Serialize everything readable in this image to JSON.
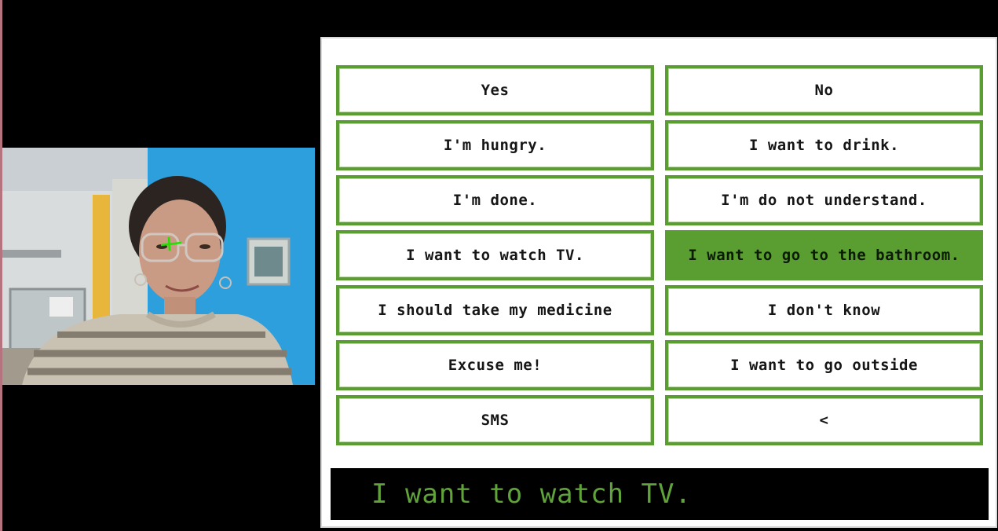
{
  "phrase_board": {
    "phrases": [
      {
        "label": "Yes",
        "selected": false
      },
      {
        "label": "No",
        "selected": false
      },
      {
        "label": "I'm hungry.",
        "selected": false
      },
      {
        "label": "I want to drink.",
        "selected": false
      },
      {
        "label": "I'm done.",
        "selected": false
      },
      {
        "label": "I'm do not understand.",
        "selected": false
      },
      {
        "label": "I want to watch TV.",
        "selected": false
      },
      {
        "label": "I want to go to the bathroom.",
        "selected": true
      },
      {
        "label": "I should take my medicine",
        "selected": false
      },
      {
        "label": "I don't know",
        "selected": false
      },
      {
        "label": "Excuse me!",
        "selected": false
      },
      {
        "label": "I want to go outside",
        "selected": false
      },
      {
        "label": "SMS",
        "selected": false
      },
      {
        "label": "<",
        "selected": false
      }
    ]
  },
  "output": {
    "text": "I want to watch TV."
  },
  "colors": {
    "accent": "#5a9e32",
    "output_text": "#5fa33a",
    "background": "#000000",
    "eye_tracker_marker": "#22e000"
  },
  "webcam": {
    "icon": "webcam-feed",
    "gaze_marker_icon": "crosshair-icon"
  }
}
